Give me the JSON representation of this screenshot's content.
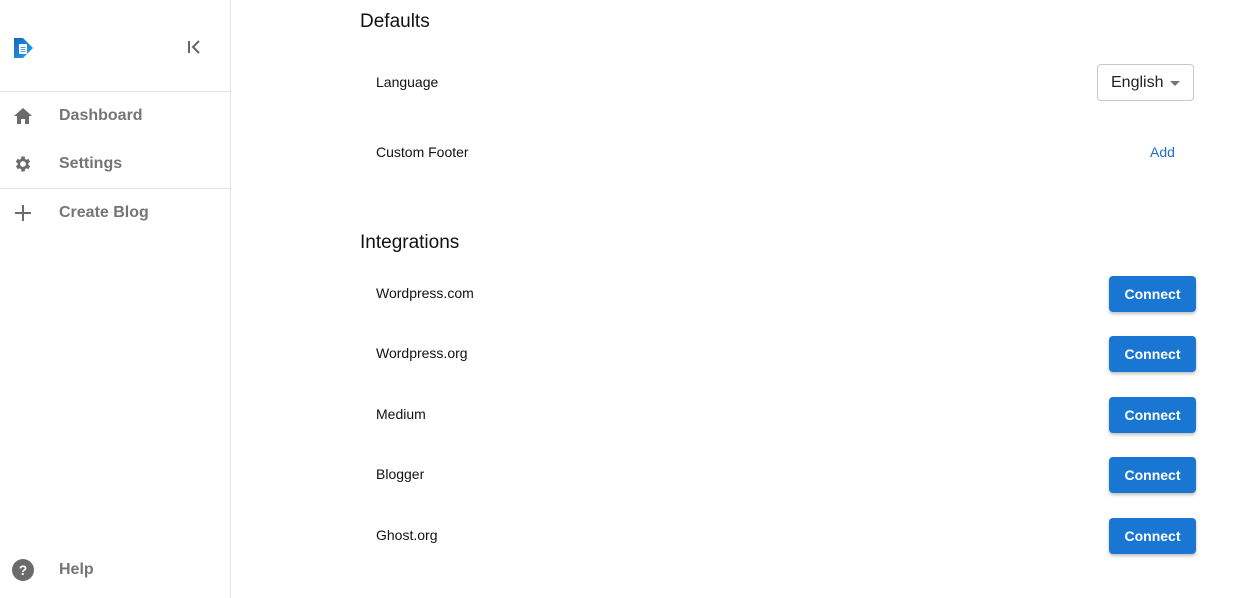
{
  "sidebar": {
    "logo_icon": "app-logo",
    "collapse_icon": "collapse-left-icon",
    "items": [
      {
        "label": "Dashboard",
        "icon": "home-icon"
      },
      {
        "label": "Settings",
        "icon": "gear-icon"
      },
      {
        "label": "Create Blog",
        "icon": "plus-icon"
      }
    ],
    "help": {
      "label": "Help",
      "icon": "help-icon"
    }
  },
  "defaults": {
    "title": "Defaults",
    "language": {
      "label": "Language",
      "selected": "English"
    },
    "custom_footer": {
      "label": "Custom Footer",
      "action": "Add"
    }
  },
  "integrations": {
    "title": "Integrations",
    "items": [
      {
        "label": "Wordpress.com",
        "action": "Connect"
      },
      {
        "label": "Wordpress.org",
        "action": "Connect"
      },
      {
        "label": "Medium",
        "action": "Connect"
      },
      {
        "label": "Blogger",
        "action": "Connect"
      },
      {
        "label": "Ghost.org",
        "action": "Connect"
      }
    ]
  },
  "colors": {
    "primary": "#1976d2",
    "link": "#1f6fc5",
    "nav_text": "#757575"
  }
}
